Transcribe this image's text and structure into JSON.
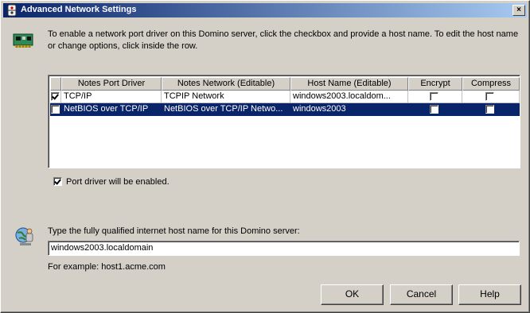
{
  "window": {
    "title": "Advanced Network Settings",
    "close_glyph": "×",
    "title_icon": "domino-icon",
    "header_icon": "network-card-icon"
  },
  "intro_text": "To enable a network port driver on this Domino server, click the checkbox and provide a host name. To edit the host name or change options, click inside the row.",
  "table": {
    "columns": [
      "Notes Port Driver",
      "Notes Network (Editable)",
      "Host Name (Editable)",
      "Encrypt",
      "Compress"
    ],
    "rows": [
      {
        "enabled": true,
        "driver": "TCP/IP",
        "network": "TCPIP Network",
        "host": "windows2003.localdom...",
        "encrypt": false,
        "compress": false,
        "selected": false
      },
      {
        "enabled": false,
        "driver": "NetBIOS over TCP/IP",
        "network": "NetBIOS over TCP/IP Netwo...",
        "host": "windows2003",
        "encrypt": false,
        "compress": false,
        "selected": true
      }
    ]
  },
  "port_driver_checkbox": {
    "label": "Port driver will be enabled.",
    "checked": true
  },
  "host": {
    "icon": "globe-user-icon",
    "prompt": "Type the fully qualified internet host name for this Domino server:",
    "value": "windows2003.localdomain",
    "example": "For example: host1.acme.com"
  },
  "buttons": {
    "ok": "OK",
    "cancel": "Cancel",
    "help": "Help"
  },
  "colors": {
    "titlebar_start": "#0a246a",
    "titlebar_end": "#a6caf0",
    "selection": "#0a246a",
    "face": "#d4d0c8"
  }
}
